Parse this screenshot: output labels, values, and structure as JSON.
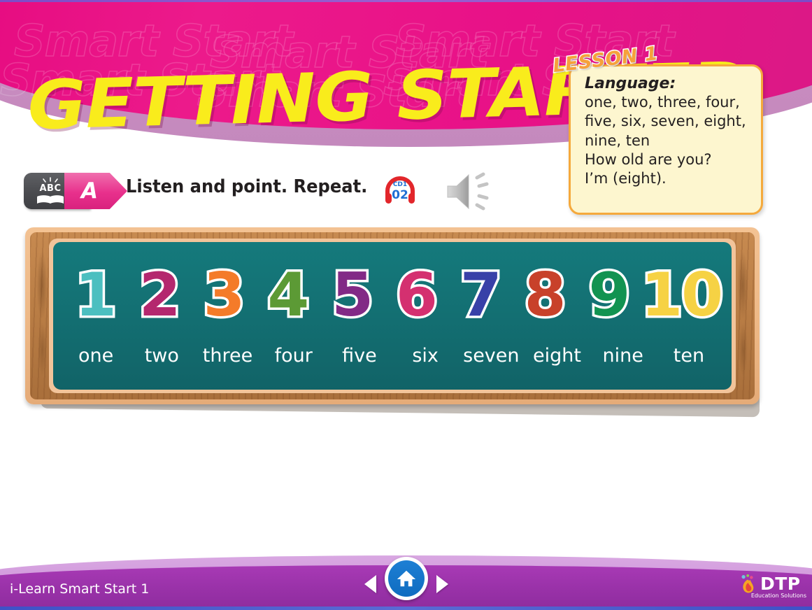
{
  "header": {
    "title": "GETTING STARTED",
    "watermark_text": "Smart Start",
    "lesson_badge": "LESSON 1"
  },
  "language_box": {
    "title": "Language:",
    "lines": [
      "one, two, three, four,",
      "five, six, seven, eight,",
      "nine, ten",
      "How old are you?",
      "I’m (eight)."
    ]
  },
  "instruction": {
    "badge_icon_label": "ABC",
    "section_letter": "A",
    "text": "Listen and point. Repeat.",
    "cd_label_top": "CD1",
    "cd_label_bottom": "02",
    "speaker_icon": "speaker-icon"
  },
  "board": {
    "items": [
      {
        "numeral": "1",
        "word": "one",
        "color": "#4cbfc0"
      },
      {
        "numeral": "2",
        "word": "two",
        "color": "#b4276e"
      },
      {
        "numeral": "3",
        "word": "three",
        "color": "#f47b29"
      },
      {
        "numeral": "4",
        "word": "four",
        "color": "#5c9a35"
      },
      {
        "numeral": "5",
        "word": "five",
        "color": "#822a86"
      },
      {
        "numeral": "6",
        "word": "six",
        "color": "#d43070"
      },
      {
        "numeral": "7",
        "word": "seven",
        "color": "#3840a8"
      },
      {
        "numeral": "8",
        "word": "eight",
        "color": "#c8412a"
      },
      {
        "numeral": "9",
        "word": "nine",
        "color": "#129351"
      },
      {
        "numeral": "10",
        "word": "ten",
        "color": "#f6d244"
      }
    ]
  },
  "footer": {
    "title": "i-Learn Smart Start 1",
    "prev_label": "previous-page",
    "home_label": "home",
    "next_label": "next-page",
    "logo_name": "DTP",
    "logo_tagline": "Education Solutions"
  },
  "colors": {
    "header_pink": "#e5097f",
    "header_mauve": "#c98cc0",
    "title_yellow": "#f9ec1c",
    "lesson_orange": "#f7a13a",
    "lang_bg": "#fdf6cf",
    "lang_border": "#f5a93c",
    "board_teal": "#147a7c",
    "wood_light": "#f0bd89",
    "wood_dark": "#b97d45",
    "footer_purple": "#9a32a9",
    "footer_light": "#d0a0dd",
    "accent_pink": "#e8308c"
  }
}
